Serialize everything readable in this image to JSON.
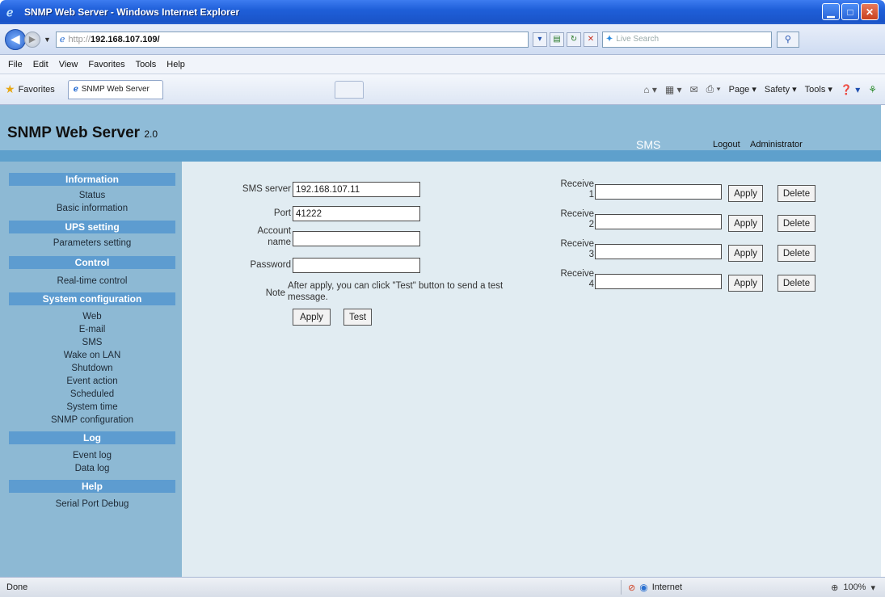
{
  "window": {
    "title": "SNMP Web Server - Windows Internet Explorer",
    "controls": {
      "minimize": "▁",
      "maximize": "□",
      "close": "✕"
    }
  },
  "address": {
    "url_protocol": "http://",
    "url_host": "192.168.107.109/",
    "search_placeholder": "Live Search"
  },
  "menu": [
    "File",
    "Edit",
    "View",
    "Favorites",
    "Tools",
    "Help"
  ],
  "favbar": {
    "favorites_label": "Favorites",
    "tab_title": "SNMP Web Server",
    "commands": {
      "page": "Page ▾",
      "safety": "Safety ▾",
      "tools": "Tools ▾"
    }
  },
  "banner": {
    "title": "SNMP Web Server",
    "version": "2.0",
    "section": "SMS",
    "logout": "Logout",
    "user": "Administrator"
  },
  "sidebar": {
    "information": {
      "heading": "Information",
      "items": [
        "Status",
        "Basic information"
      ]
    },
    "ups": {
      "heading": "UPS setting",
      "items": [
        "Parameters setting"
      ]
    },
    "control": {
      "heading": "Control",
      "items": [
        "Real-time control"
      ]
    },
    "system": {
      "heading": "System configuration",
      "items": [
        "Web",
        "E-mail",
        "SMS",
        "Wake on LAN",
        "Shutdown",
        "Event action",
        "Scheduled",
        "System time",
        "SNMP configuration"
      ]
    },
    "log": {
      "heading": "Log",
      "items": [
        "Event log",
        "Data log"
      ]
    },
    "help": {
      "heading": "Help",
      "items": [
        "Serial Port Debug"
      ]
    }
  },
  "form": {
    "sms_server_label": "SMS server",
    "sms_server_value": "192.168.107.11",
    "port_label": "Port",
    "port_value": "41222",
    "account_label_1": "Account",
    "account_label_2": "name",
    "account_value": "",
    "password_label": "Password",
    "password_value": "",
    "note_label": "Note",
    "note_text": "After apply, you can click \"Test\" button to send a test message.",
    "apply_label": "Apply",
    "test_label": "Test"
  },
  "receivers": [
    {
      "label_1": "Receive",
      "label_2": "1",
      "value": "",
      "apply": "Apply",
      "delete": "Delete"
    },
    {
      "label_1": "Receive",
      "label_2": "2",
      "value": "",
      "apply": "Apply",
      "delete": "Delete"
    },
    {
      "label_1": "Receive",
      "label_2": "3",
      "value": "",
      "apply": "Apply",
      "delete": "Delete"
    },
    {
      "label_1": "Receive",
      "label_2": "4",
      "value": "",
      "apply": "Apply",
      "delete": "Delete"
    }
  ],
  "status": {
    "text": "Done",
    "zone": "Internet",
    "zoom": "100%"
  }
}
